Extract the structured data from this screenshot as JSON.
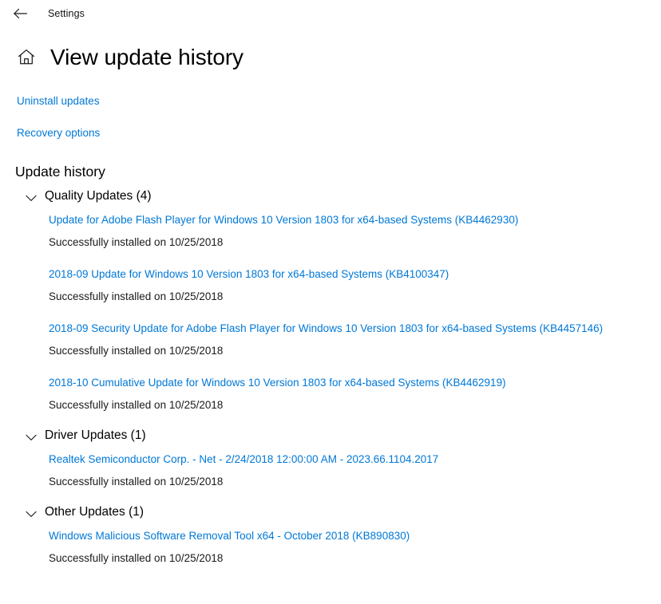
{
  "window": {
    "app_name": "Settings",
    "back_icon": "back-arrow-icon"
  },
  "header": {
    "home_icon": "home-icon",
    "title": "View update history"
  },
  "colors": {
    "link": "#0078d7",
    "text": "#000000",
    "background": "#ffffff"
  },
  "top_links": [
    {
      "label": "Uninstall updates"
    },
    {
      "label": "Recovery options"
    }
  ],
  "history": {
    "heading": "Update history",
    "groups": [
      {
        "title": "Quality Updates (4)",
        "expanded": true,
        "chevron_icon": "chevron-down-icon",
        "entries": [
          {
            "name": "Update for Adobe Flash Player for Windows 10 Version 1803 for x64-based Systems (KB4462930)",
            "status": "Successfully installed on 10/25/2018"
          },
          {
            "name": "2018-09 Update for Windows 10 Version 1803 for x64-based Systems (KB4100347)",
            "status": "Successfully installed on 10/25/2018"
          },
          {
            "name": "2018-09 Security Update for Adobe Flash Player for Windows 10 Version 1803 for x64-based Systems (KB4457146)",
            "status": "Successfully installed on 10/25/2018"
          },
          {
            "name": "2018-10 Cumulative Update for Windows 10 Version 1803 for x64-based Systems (KB4462919)",
            "status": "Successfully installed on 10/25/2018"
          }
        ]
      },
      {
        "title": "Driver Updates (1)",
        "expanded": true,
        "chevron_icon": "chevron-down-icon",
        "entries": [
          {
            "name": "Realtek Semiconductor Corp. - Net - 2/24/2018 12:00:00 AM - 2023.66.1104.2017",
            "status": "Successfully installed on 10/25/2018"
          }
        ]
      },
      {
        "title": "Other Updates (1)",
        "expanded": true,
        "chevron_icon": "chevron-down-icon",
        "entries": [
          {
            "name": "Windows Malicious Software Removal Tool x64 - October 2018 (KB890830)",
            "status": "Successfully installed on 10/25/2018"
          }
        ]
      }
    ]
  }
}
